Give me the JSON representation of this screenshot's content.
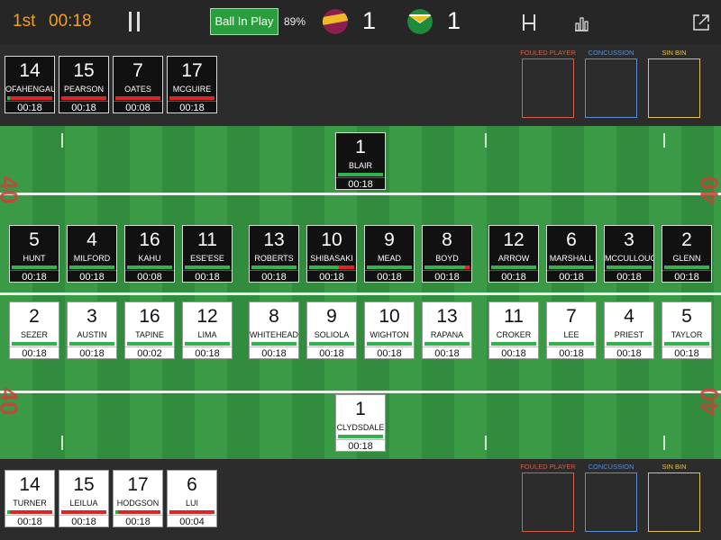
{
  "header": {
    "period": "1st",
    "clock": "00:18",
    "ball_in_play_label": "Ball In Play",
    "ball_in_play_pct": "89%",
    "home_score": "1",
    "away_score": "1"
  },
  "labels": {
    "fouled": "FOULED PLAYER",
    "concussion": "CONCUSSION",
    "sin_bin": "SIN BIN"
  },
  "field_marks": [
    "40",
    "40",
    "40",
    "40"
  ],
  "colors": {
    "home_primary": "#8a2050",
    "home_secondary": "#f0b92a",
    "away_primary": "#1e8a3c",
    "away_secondary": "#f0c020",
    "card_green": "#31b44b",
    "card_red": "#e02424",
    "fouled_border": "#d0604a",
    "concussion_border": "#5a8ed0",
    "sinbin_border": "#e0c060"
  },
  "top_bench": [
    {
      "num": "14",
      "name": "OFAHENGAUE",
      "time": "00:18",
      "bar": "red",
      "green_frac": 0.05
    },
    {
      "num": "15",
      "name": "PEARSON",
      "time": "00:18",
      "bar": "red",
      "green_frac": 0
    },
    {
      "num": "7",
      "name": "OATES",
      "time": "00:08",
      "bar": "red",
      "green_frac": 0
    },
    {
      "num": "17",
      "name": "MCGUIRE",
      "time": "00:18",
      "bar": "red",
      "green_frac": 0
    }
  ],
  "top_fullback": {
    "num": "1",
    "name": "BLAIR",
    "time": "00:18",
    "bar": "green"
  },
  "top_row": [
    {
      "num": "5",
      "name": "HUNT",
      "time": "00:18",
      "bar": "green"
    },
    {
      "num": "4",
      "name": "MILFORD",
      "time": "00:18",
      "bar": "green"
    },
    {
      "num": "16",
      "name": "KAHU",
      "time": "00:08",
      "bar": "green"
    },
    {
      "num": "11",
      "name": "ESE'ESE",
      "time": "00:18",
      "bar": "green"
    },
    {
      "num": "13",
      "name": "ROBERTS",
      "time": "00:18",
      "bar": "green"
    },
    {
      "num": "10",
      "name": "SHIBASAKI",
      "time": "00:18",
      "bar": "green",
      "red_frac": 0.35
    },
    {
      "num": "9",
      "name": "MEAD",
      "time": "00:18",
      "bar": "green"
    },
    {
      "num": "8",
      "name": "BOYD",
      "time": "00:18",
      "bar": "green",
      "red_frac": 0.1
    },
    {
      "num": "12",
      "name": "ARROW",
      "time": "00:18",
      "bar": "green"
    },
    {
      "num": "6",
      "name": "MARSHALL",
      "time": "00:18",
      "bar": "green"
    },
    {
      "num": "3",
      "name": "MCCULLOUGH",
      "time": "00:18",
      "bar": "green"
    },
    {
      "num": "2",
      "name": "GLENN",
      "time": "00:18",
      "bar": "green"
    }
  ],
  "bottom_row": [
    {
      "num": "2",
      "name": "SEZER",
      "time": "00:18",
      "bar": "green"
    },
    {
      "num": "3",
      "name": "AUSTIN",
      "time": "00:18",
      "bar": "green"
    },
    {
      "num": "16",
      "name": "TAPINE",
      "time": "00:02",
      "bar": "green"
    },
    {
      "num": "12",
      "name": "LIMA",
      "time": "00:18",
      "bar": "green"
    },
    {
      "num": "8",
      "name": "WHITEHEAD",
      "time": "00:18",
      "bar": "green"
    },
    {
      "num": "9",
      "name": "SOLIOLA",
      "time": "00:18",
      "bar": "green"
    },
    {
      "num": "10",
      "name": "WIGHTON",
      "time": "00:18",
      "bar": "green"
    },
    {
      "num": "13",
      "name": "RAPANA",
      "time": "00:18",
      "bar": "green"
    },
    {
      "num": "11",
      "name": "CROKER",
      "time": "00:18",
      "bar": "green"
    },
    {
      "num": "7",
      "name": "LEE",
      "time": "00:18",
      "bar": "green"
    },
    {
      "num": "4",
      "name": "PRIEST",
      "time": "00:18",
      "bar": "green"
    },
    {
      "num": "5",
      "name": "TAYLOR",
      "time": "00:18",
      "bar": "green"
    }
  ],
  "bottom_fullback": {
    "num": "1",
    "name": "CLYDSDALE",
    "time": "00:18",
    "bar": "green"
  },
  "bottom_bench": [
    {
      "num": "14",
      "name": "TURNER",
      "time": "00:18",
      "bar": "red",
      "green_frac": 0.05
    },
    {
      "num": "15",
      "name": "LEILUA",
      "time": "00:18",
      "bar": "red",
      "green_frac": 0
    },
    {
      "num": "17",
      "name": "HODGSON",
      "time": "00:18",
      "bar": "red",
      "green_frac": 0.05
    },
    {
      "num": "6",
      "name": "LUI",
      "time": "00:04",
      "bar": "red",
      "green_frac": 0
    }
  ]
}
